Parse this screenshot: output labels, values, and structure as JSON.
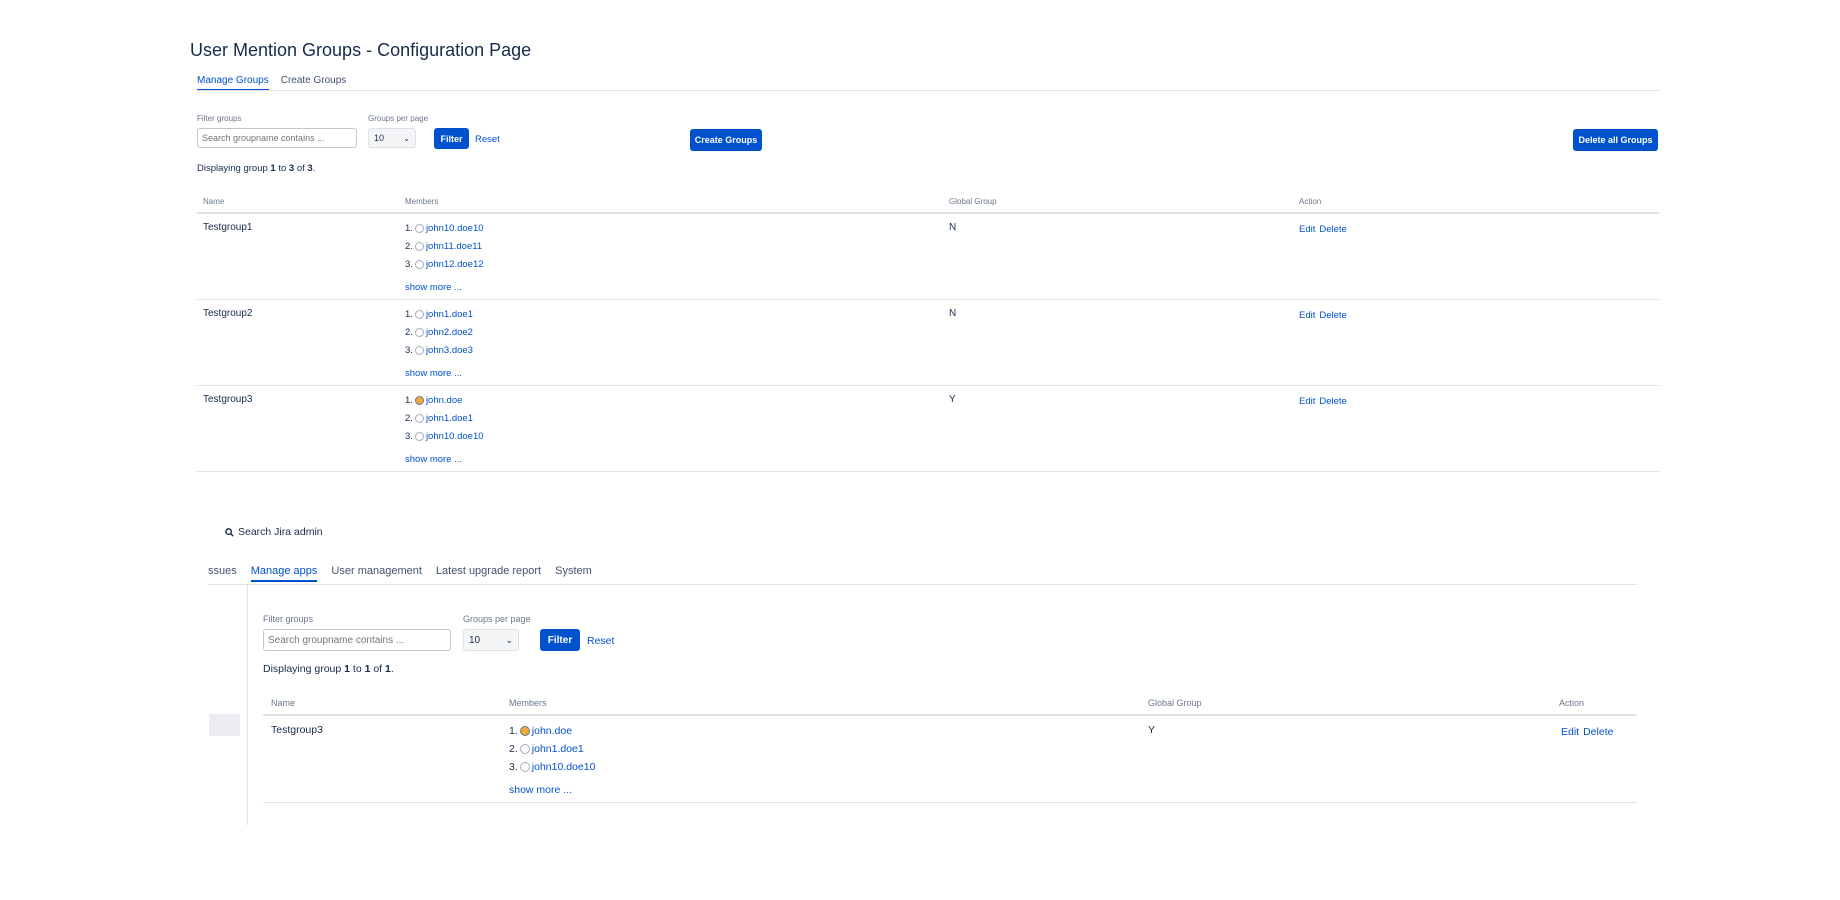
{
  "page": {
    "title": "User Mention Groups - Configuration Page"
  },
  "tabs": [
    {
      "label": "Manage Groups"
    },
    {
      "label": "Create Groups"
    }
  ],
  "filter": {
    "filter_label": "Filter groups",
    "search_placeholder": "Search groupname contains ...",
    "per_page_label": "Groups per page",
    "per_page_value": "10",
    "filter_button": "Filter",
    "reset_link": "Reset"
  },
  "actions": {
    "create_groups": "Create Groups",
    "delete_all": "Delete all Groups"
  },
  "display": {
    "prefix": "Displaying group ",
    "from": "1",
    "to_word": " to ",
    "to": "3",
    "of_word": " of ",
    "total": "3",
    "suffix": "."
  },
  "table": {
    "headers": {
      "name": "Name",
      "members": "Members",
      "global": "Global Group",
      "action": "Action"
    },
    "rows": [
      {
        "name": "Testgroup1",
        "members": [
          "john10.doe10",
          "john11.doe11",
          "john12.doe12"
        ],
        "global": "N"
      },
      {
        "name": "Testgroup2",
        "members": [
          "john1.doe1",
          "john2.doe2",
          "john3.doe3"
        ],
        "global": "N"
      },
      {
        "name": "Testgroup3",
        "members": [
          "john.doe",
          "john1.doe1",
          "john10.doe10"
        ],
        "global": "Y"
      }
    ],
    "show_more": "show more ...",
    "edit": "Edit",
    "delete": "Delete",
    "numbers": [
      "1.",
      "2.",
      "3."
    ]
  },
  "admin": {
    "search_label": "Search Jira admin",
    "tabs": [
      {
        "label": "ssues"
      },
      {
        "label": "Manage apps"
      },
      {
        "label": "User management"
      },
      {
        "label": "Latest upgrade report"
      },
      {
        "label": "System"
      }
    ],
    "filter": {
      "filter_label": "Filter groups",
      "search_placeholder": "Search groupname contains ...",
      "per_page_label": "Groups per page",
      "per_page_value": "10",
      "filter_button": "Filter",
      "reset_link": "Reset"
    },
    "display": {
      "prefix": "Displaying group ",
      "from": "1",
      "to_word": " to ",
      "to": "1",
      "of_word": " of ",
      "total": "1",
      "suffix": "."
    },
    "headers": {
      "name": "Name",
      "members": "Members",
      "global": "Global Group",
      "action": "Action"
    },
    "row": {
      "name": "Testgroup3",
      "members": [
        "john.doe",
        "john1.doe1",
        "john10.doe10"
      ],
      "global": "Y"
    },
    "show_more": "show more ...",
    "edit": "Edit",
    "delete": "Delete"
  },
  "colors": {
    "accent": "#0052cc",
    "text": "#172b4d",
    "muted": "#6b778c",
    "border": "#dfe1e6"
  }
}
